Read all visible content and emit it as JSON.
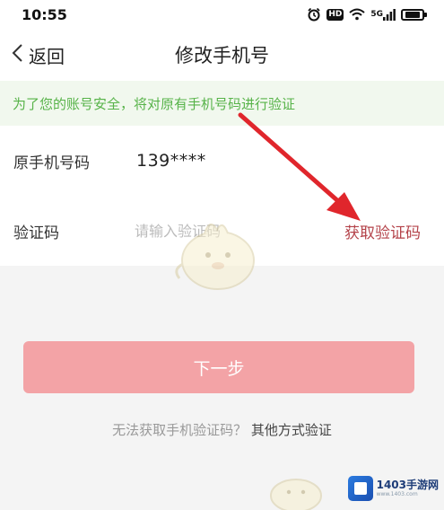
{
  "status_bar": {
    "time": "10:55",
    "icons": [
      "alarm-icon",
      "hd-badge",
      "wifi-icon",
      "cellular-signal-icon",
      "battery-icon"
    ],
    "hd_label": "HD",
    "network_label": "5G"
  },
  "nav": {
    "back_label": "返回",
    "title": "修改手机号"
  },
  "notice": {
    "text": "为了您的账号安全，将对原有手机号码进行验证"
  },
  "form": {
    "phone_label": "原手机号码",
    "phone_value": "139****",
    "code_label": "验证码",
    "code_placeholder": "请输入验证码",
    "code_value": "",
    "get_code_label": "获取验证码"
  },
  "next_button": {
    "label": "下一步"
  },
  "alt_verify": {
    "prefix": "无法获取手机验证码？",
    "link": "其他方式验证"
  },
  "branding": {
    "logo_name": "1403手游网",
    "logo_sub": "www.1403.com"
  },
  "colors": {
    "notice_text": "#57b349",
    "notice_bg": "#f1f8ee",
    "accent_red": "#b4434a",
    "button_disabled": "#f3a3a6",
    "arrow_red": "#e0262c"
  }
}
